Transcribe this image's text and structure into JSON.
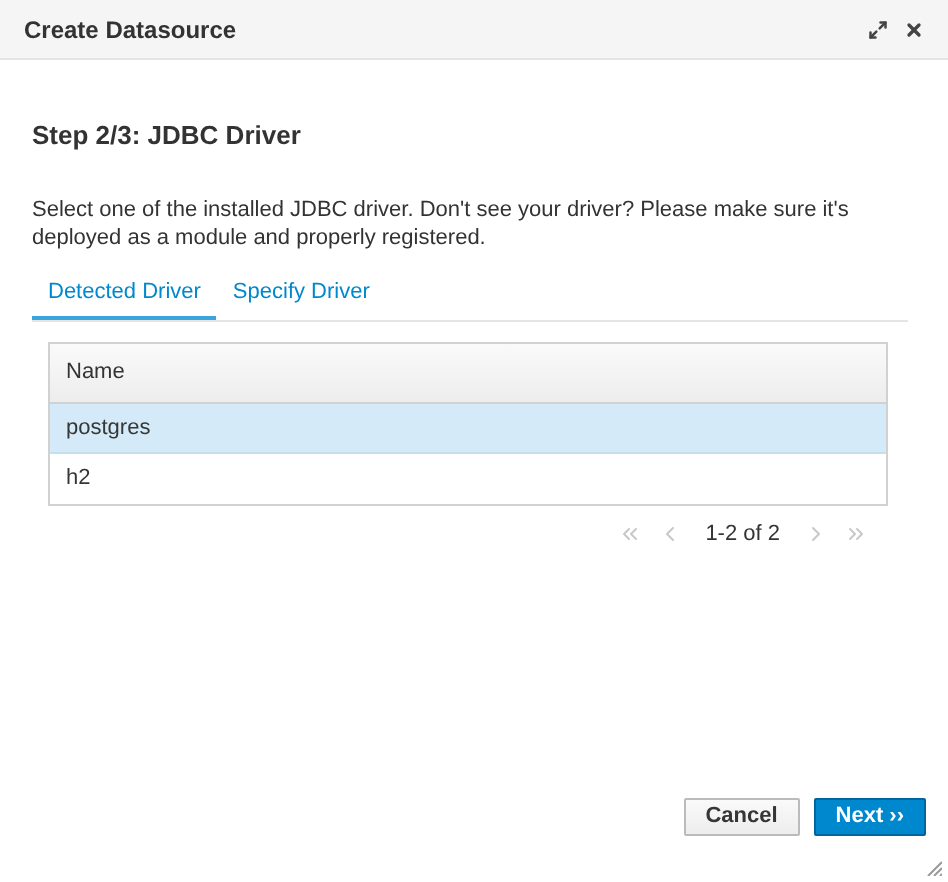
{
  "dialog": {
    "title": "Create Datasource"
  },
  "step_title": "Step 2/3: JDBC Driver",
  "description": "Select one of the installed JDBC driver. Don't see your driver? Please make sure it's deployed as a module and properly registered.",
  "tabs": [
    {
      "label": "Detected Driver",
      "selected": true
    },
    {
      "label": "Specify Driver",
      "selected": false
    }
  ],
  "table": {
    "columns": [
      "Name"
    ],
    "rows": [
      {
        "name": "postgres",
        "selected": true
      },
      {
        "name": "h2",
        "selected": false
      }
    ]
  },
  "pager": {
    "range": "1-2 of 2"
  },
  "buttons": [
    {
      "label": "Cancel",
      "kind": "secondary"
    },
    {
      "label": "Next ››",
      "kind": "primary"
    }
  ]
}
